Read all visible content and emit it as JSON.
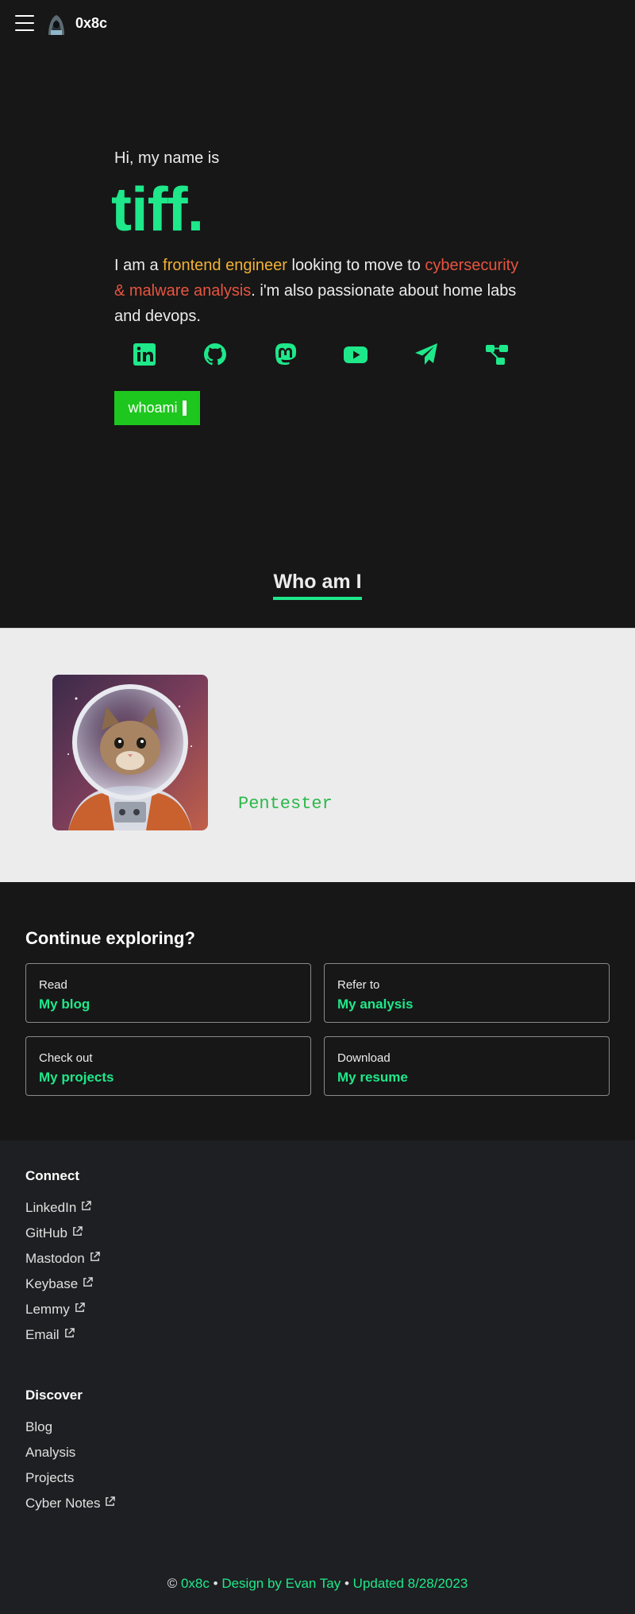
{
  "nav": {
    "brand": "0x8c"
  },
  "hero": {
    "greeting": "Hi, my name is",
    "name": "tiff.",
    "intro_prefix": "I am a ",
    "intro_role": "frontend engineer",
    "intro_mid": " looking to move to ",
    "intro_goal": "cybersecurity & malware analysis",
    "intro_suffix": ". i'm also passionate about home labs and devops.",
    "socials": [
      "linkedin-icon",
      "github-icon",
      "mastodon-icon",
      "youtube-icon",
      "telegram-icon",
      "keybase-icon"
    ],
    "whoami_label": "whoami"
  },
  "about": {
    "heading": "Who am I",
    "role": "Pentester"
  },
  "explore": {
    "heading": "Continue exploring?",
    "cards": [
      {
        "kicker": "Read",
        "title": "My blog"
      },
      {
        "kicker": "Refer to",
        "title": "My analysis"
      },
      {
        "kicker": "Check out",
        "title": "My projects"
      },
      {
        "kicker": "Download",
        "title": "My resume"
      }
    ]
  },
  "footer": {
    "connect_heading": "Connect",
    "connect_links": [
      "LinkedIn",
      "GitHub",
      "Mastodon",
      "Keybase",
      "Lemmy",
      "Email"
    ],
    "discover_heading": "Discover",
    "discover_links": [
      "Blog",
      "Analysis",
      "Projects",
      "Cyber Notes"
    ],
    "copyright_symbol": "©",
    "copyright_brand": "0x8c",
    "design_credit": "Design by Evan Tay",
    "updated": "Updated 8/28/2023",
    "separator": "•"
  },
  "colors": {
    "accent": "#1ee88a",
    "button": "#1ec71e",
    "highlight_yellow": "#f2b134",
    "highlight_red": "#e8543f",
    "background": "#171717",
    "footer_bg": "#1e1f22",
    "about_bg": "#ececec"
  }
}
